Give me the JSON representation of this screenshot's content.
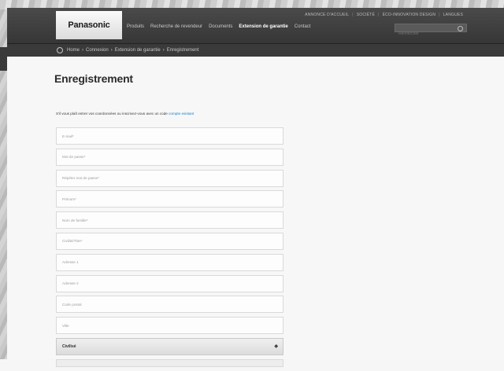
{
  "header": {
    "logo": "Panasonic",
    "utility_links": [
      "ANNONCE D'ACCUEIL",
      "SOCIÉTÉ",
      "ÉCO-INNOVATION DESIGN",
      "LANGUES"
    ],
    "nav": [
      "Produits",
      "Recherche de revendeur",
      "Documents",
      "Extension de garantie",
      "Contact"
    ],
    "active_nav": "Extension de garantie",
    "search_placeholder": "Rechercher"
  },
  "breadcrumb": [
    "Home",
    "Connexion",
    "Extension de garantie",
    "Enregistrement"
  ],
  "page": {
    "title": "Enregistrement",
    "intro_text": "S'il vous plaît entrer vos coordonnées ou inscrivez-vous avec un code",
    "intro_link": "compte existant"
  },
  "form_fields": [
    "E-mail*",
    "Mot de passe*",
    "Répéter mot de passe*",
    "Prénom*",
    "Nom de famille*",
    "Civilité/Titre*",
    "Adresse 1",
    "Adresse 2",
    "Code postal",
    "Ville"
  ],
  "select": {
    "value": "Civilisé",
    "chevron": "chevron-down-icon"
  }
}
